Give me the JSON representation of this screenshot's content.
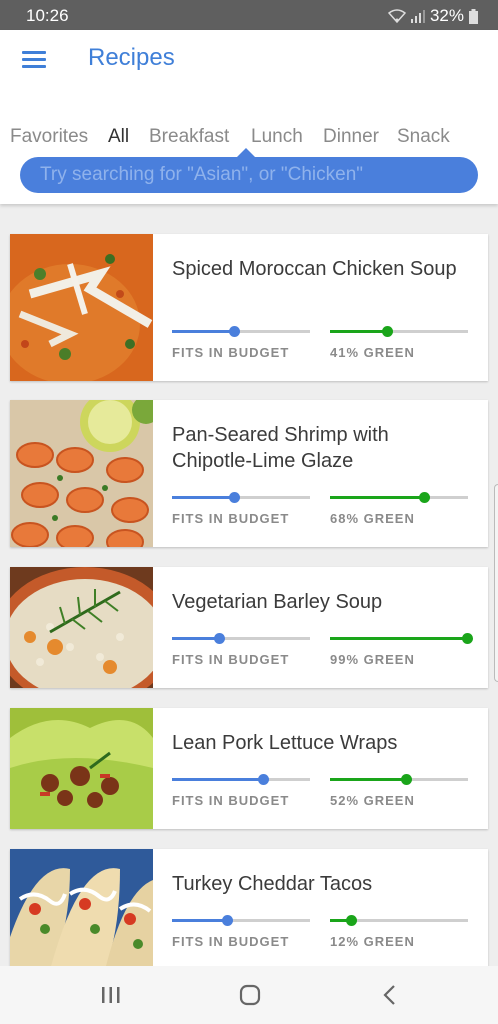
{
  "status_bar": {
    "time": "10:26",
    "battery": "32%"
  },
  "header": {
    "title": "Recipes",
    "tabs": [
      "Favorites",
      "All",
      "Breakfast",
      "Lunch",
      "Dinner",
      "Snack"
    ],
    "active_tab": "All",
    "search_placeholder": "Try searching for \"Asian\", or \"Chicken\""
  },
  "colors": {
    "accent": "#3f7fd8",
    "search_bg": "#4a7fdc",
    "budget": "#4a7fdc",
    "green": "#1aa51a",
    "track": "#cfcfcf"
  },
  "recipes": [
    {
      "name": "Spiced Moroccan Chicken Soup",
      "budget_label": "FITS IN BUDGET",
      "budget_level": 0.45,
      "green_label": "41% GREEN",
      "green_level": 0.41,
      "image": "chicken-soup-image"
    },
    {
      "name": "Pan-Seared Shrimp with Chipotle-Lime Glaze",
      "budget_label": "FITS IN BUDGET",
      "budget_level": 0.45,
      "green_label": "68% GREEN",
      "green_level": 0.68,
      "image": "shrimp-image"
    },
    {
      "name": "Vegetarian Barley Soup",
      "budget_label": "FITS IN BUDGET",
      "budget_level": 0.34,
      "green_label": "99% GREEN",
      "green_level": 0.99,
      "image": "barley-soup-image"
    },
    {
      "name": "Lean Pork Lettuce Wraps",
      "budget_label": "FITS IN BUDGET",
      "budget_level": 0.66,
      "green_label": "52% GREEN",
      "green_level": 0.55,
      "image": "lettuce-wraps-image"
    },
    {
      "name": "Turkey Cheddar Tacos",
      "budget_label": "FITS IN BUDGET",
      "budget_level": 0.4,
      "green_label": "12% GREEN",
      "green_level": 0.15,
      "image": "tacos-image"
    }
  ],
  "nav_bar": {
    "buttons": [
      "recent-apps-icon",
      "home-icon",
      "back-icon"
    ]
  }
}
